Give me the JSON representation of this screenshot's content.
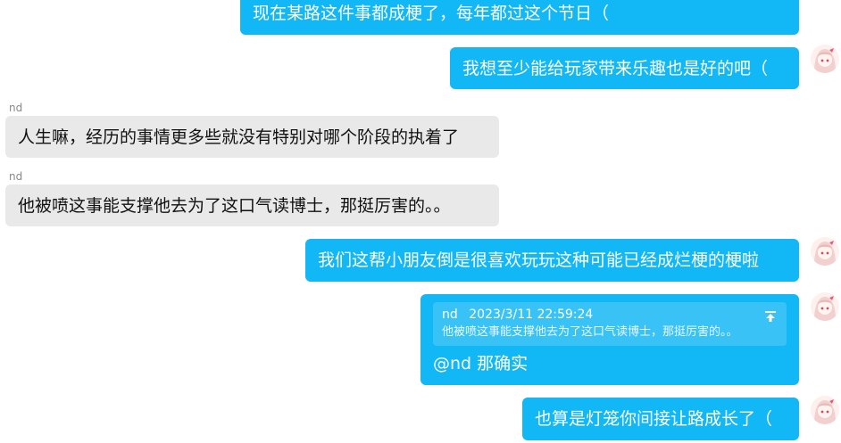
{
  "messages": [
    {
      "text": "现在某路这件事都成梗了，每年都过这个节日（"
    },
    {
      "text": "我想至少能给玩家带来乐趣也是好的吧（"
    },
    {
      "sender": "nd",
      "text": "人生嘛，经历的事情更多些就没有特别对哪个阶段的执着了"
    },
    {
      "sender": "nd",
      "text": "他被喷这事能支撑他去为了这口气读博士，那挺厉害的。。"
    },
    {
      "text": "我们这帮小朋友倒是很喜欢玩玩这种可能已经成烂梗的梗啦"
    },
    {
      "quote_sender": "nd",
      "quote_time": "2023/3/11 22:59:24",
      "quote_text": "他被喷这事能支撑他去为了这口气读博士，那挺厉害的。。",
      "text": "@nd 那确实"
    },
    {
      "text": "也算是灯笼你间接让路成长了（"
    }
  ],
  "colors": {
    "outgoing_bubble": "#12b7f5",
    "incoming_bubble": "#e9e9e9"
  },
  "icons": {
    "avatar": "anime-girl-avatar-icon",
    "jump": "jump-to-message-icon"
  }
}
